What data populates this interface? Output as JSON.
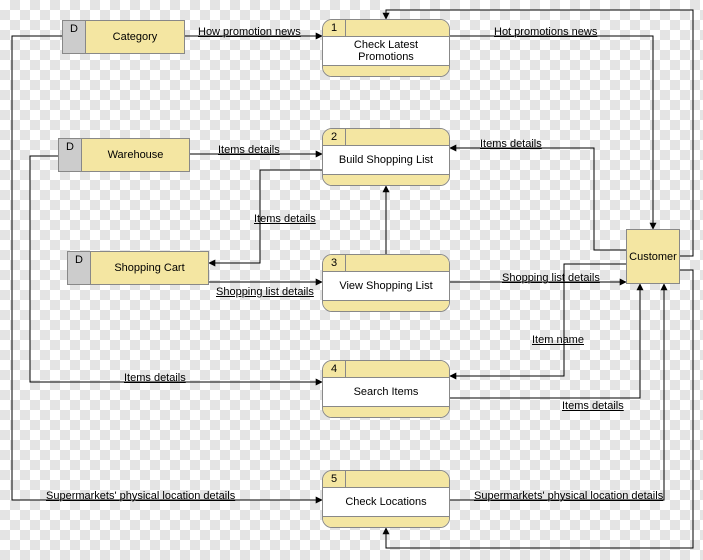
{
  "diagram_type": "data-flow-diagram",
  "stores": {
    "category": {
      "tag": "D",
      "label": "Category"
    },
    "warehouse": {
      "tag": "D",
      "label": "Warehouse"
    },
    "shopping_cart": {
      "tag": "D",
      "label": "Shopping Cart"
    }
  },
  "processes": {
    "p1": {
      "num": "1",
      "label": "Check Latest Promotions"
    },
    "p2": {
      "num": "2",
      "label": "Build Shopping List"
    },
    "p3": {
      "num": "3",
      "label": "View Shopping List"
    },
    "p4": {
      "num": "4",
      "label": "Search Items"
    },
    "p5": {
      "num": "5",
      "label": "Check Locations"
    }
  },
  "entities": {
    "customer": {
      "label": "Customer"
    }
  },
  "flows": {
    "f1": "How promotion news",
    "f2": "Hot promotions news",
    "f3": "Items details",
    "f4": "Items details",
    "f5": "Items details",
    "f6": "Shopping list details",
    "f7": "Shopping list details",
    "f8": "Item name",
    "f9": "Items details",
    "f10": "Items details",
    "f11": "Supermarkets' physical location details",
    "f12": "Supermarkets' physical location details"
  }
}
